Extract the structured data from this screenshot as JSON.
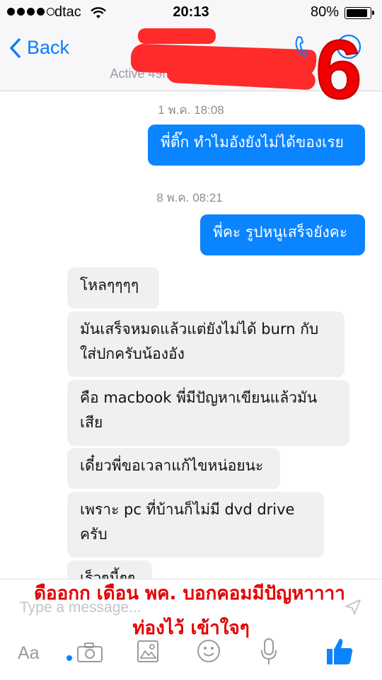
{
  "status_bar": {
    "carrier": "dtac",
    "time": "20:13",
    "battery": "80%"
  },
  "header": {
    "back_label": "Back",
    "active_status": "Active 49m ago · Messenger",
    "overlay_number": "6"
  },
  "messages": {
    "timestamp_1": "1 พ.ค. 18:08",
    "out_1": "พี่ติ๊ก ทำไมอังยังไม่ได้ของเรย",
    "timestamp_2": "8 พ.ค. 08:21",
    "out_2": "พี่คะ รูปหนูเสร็จยังคะ",
    "in_1": "โหลๆๆๆๆ",
    "in_2_line1": "มันเสร็จหมดแล้วแต่ยังไม่ได้ burn กับ",
    "in_2_line2": "ใส่ปกครับน้องอัง",
    "in_3_line1": "คือ macbook พี่มีปัญหาเขียนแล้วมัน",
    "in_3_line2": "เสีย",
    "in_4": "เดี๋ยวพี่ขอเวลาแก้ไขหน่อยนะ",
    "in_5_line1": "เพราะ pc ที่บ้านก็ไม่มี dvd drive",
    "in_5_line2": "ครับ",
    "in_6_partial": "เร็วๆนี้ๆๆ"
  },
  "composer": {
    "placeholder": "Type a message..."
  },
  "toolbar": {
    "text_label": "Aa"
  },
  "caption": {
    "line1": "ดืออกก เดือน พค. บอกคอมมีปัญหาาาา",
    "line2": "ท่องไว้ เข้าใจๆ"
  },
  "colors": {
    "accent": "#0a84ff",
    "caption": "#e30000"
  }
}
